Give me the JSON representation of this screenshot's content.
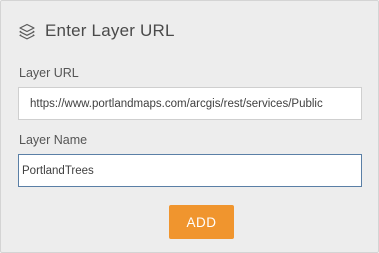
{
  "dialog": {
    "title": "Enter Layer URL",
    "header_icon": "layers-icon"
  },
  "layer_url": {
    "label": "Layer URL",
    "value": "https://www.portlandmaps.com/arcgis/rest/services/Public"
  },
  "layer_name": {
    "label": "Layer Name",
    "value": "PortlandTrees"
  },
  "add_button": {
    "label": "ADD",
    "color": "#f0952e"
  },
  "colors": {
    "panel_background": "#ededed",
    "focused_input_border": "#5a7fa6"
  }
}
